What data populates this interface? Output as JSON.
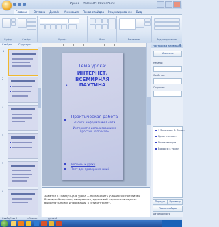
{
  "window": {
    "title": "Урок1 - Microsoft PowerPoint"
  },
  "menu": {
    "tabs": [
      "Главная",
      "Вставка",
      "Дизайн",
      "Анимация",
      "Показ слайдов",
      "Рецензирование",
      "Вид"
    ]
  },
  "ribbon": {
    "groups": [
      "Буфер",
      "Слайды",
      "Шрифт",
      "Абзац",
      "Рисование",
      "Редактирование"
    ]
  },
  "outline_tabs": {
    "slides": "Слайды",
    "outline": "Структура"
  },
  "thumbnails": [
    {
      "num": "1"
    },
    {
      "num": "2"
    },
    {
      "num": "3"
    },
    {
      "num": "4"
    },
    {
      "num": "5"
    },
    {
      "num": "6"
    }
  ],
  "slide": {
    "title_line1": "Тема урока:",
    "title_line2": "ИНТЕРНЕТ. ВСЕМИРНАЯ ПАУТИНА",
    "body_heading": "Практическая работа",
    "body_line1": "«Поиск информации в сети",
    "body_line2": "Интернет с использованием простых запросов»",
    "link1": "Вопросы к уроку",
    "link2": "Тест для проверки знаний"
  },
  "notes": {
    "text": "Заметки к слайду: цель урока — познакомить учащихся с понятиями Всемирной паутины, гипертекста, адреса веб-страницы и научить выполнять поиск информации в сети Интернет."
  },
  "task_pane": {
    "title": "Настройка анимации",
    "label_change": "Изменить",
    "label_start": "Начало:",
    "label_property": "Свойство:",
    "label_speed": "Скорость:",
    "items": [
      "1 Заголовок 1: Тема...",
      "Практическая...",
      "Поиск информ...",
      "Вопросы к уроку"
    ],
    "btn_order": "Порядок",
    "btn_play": "Просмотр",
    "btn_show": "Показ слайдов",
    "checkbox_label": "Автопросмотр"
  },
  "statusbar": {
    "slide_info": "Слайд 1 из 6",
    "theme": "«Поток»",
    "language": "русский"
  }
}
